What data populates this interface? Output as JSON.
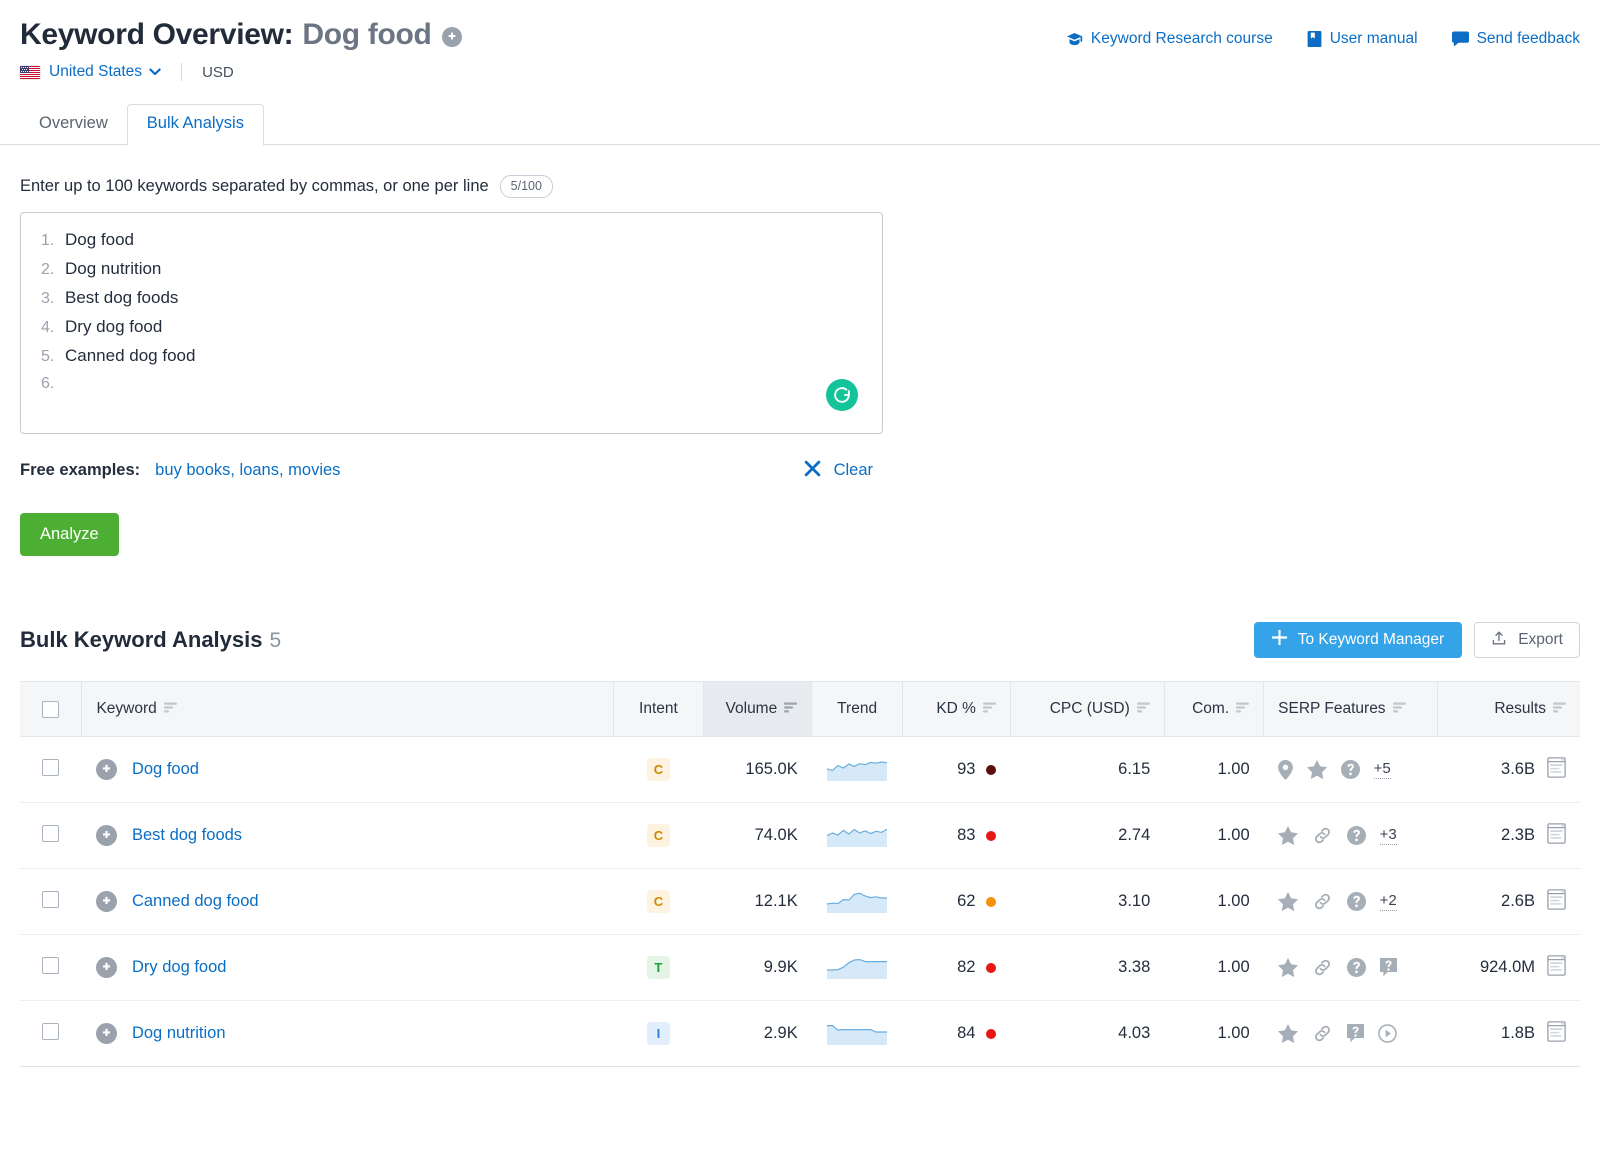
{
  "header": {
    "title_prefix": "Keyword Overview:",
    "keyword": "Dog food",
    "add_icon": "plus-circle-icon",
    "links": [
      {
        "label": "Keyword Research course",
        "icon": "graduation-cap-icon"
      },
      {
        "label": "User manual",
        "icon": "book-icon"
      },
      {
        "label": "Send feedback",
        "icon": "speech-bubble-icon"
      }
    ],
    "locale": {
      "country": "United States",
      "flag": "us-flag-icon",
      "chevron": "chevron-down-icon",
      "currency": "USD"
    }
  },
  "tabs": [
    {
      "label": "Overview",
      "active": false
    },
    {
      "label": "Bulk Analysis",
      "active": true
    }
  ],
  "input_section": {
    "instruction": "Enter up to 100 keywords separated by commas, or one per line",
    "counter": "5/100",
    "lines": [
      {
        "num": "1.",
        "text": "Dog food"
      },
      {
        "num": "2.",
        "text": "Dog nutrition"
      },
      {
        "num": "3.",
        "text": "Best dog foods"
      },
      {
        "num": "4.",
        "text": "Dry dog food"
      },
      {
        "num": "5.",
        "text": "Canned dog food"
      },
      {
        "num": "6.",
        "text": ""
      }
    ],
    "grammarly_icon": "grammarly-icon",
    "examples_label": "Free examples:",
    "examples_link": "buy books, loans, movies",
    "clear_label": "Clear",
    "clear_icon": "close-x-icon",
    "analyze_label": "Analyze"
  },
  "results": {
    "title": "Bulk Keyword Analysis",
    "count": "5",
    "to_keyword_manager_label": "To Keyword Manager",
    "to_keyword_manager_icon": "plus-icon",
    "export_label": "Export",
    "export_icon": "upload-icon",
    "columns": [
      {
        "key": "checkbox",
        "label": "",
        "sortable": false,
        "align": "center"
      },
      {
        "key": "keyword",
        "label": "Keyword",
        "sortable": true,
        "align": "left"
      },
      {
        "key": "intent",
        "label": "Intent",
        "sortable": false,
        "align": "center"
      },
      {
        "key": "volume",
        "label": "Volume",
        "sortable": true,
        "align": "right",
        "highlighted": true
      },
      {
        "key": "trend",
        "label": "Trend",
        "sortable": false,
        "align": "center"
      },
      {
        "key": "kd",
        "label": "KD %",
        "sortable": true,
        "align": "right"
      },
      {
        "key": "cpc",
        "label": "CPC (USD)",
        "sortable": true,
        "align": "right"
      },
      {
        "key": "com",
        "label": "Com.",
        "sortable": true,
        "align": "right"
      },
      {
        "key": "serp",
        "label": "SERP Features",
        "sortable": true,
        "align": "left"
      },
      {
        "key": "results",
        "label": "Results",
        "sortable": true,
        "align": "right"
      }
    ],
    "rows": [
      {
        "keyword": "Dog food",
        "intent": "C",
        "volume": "165.0K",
        "trend": [
          0.45,
          0.38,
          0.62,
          0.5,
          0.7,
          0.58,
          0.72,
          0.66,
          0.78,
          0.74,
          0.8,
          0.76
        ],
        "kd": "93",
        "kd_color": "#5c0d0d",
        "cpc": "6.15",
        "com": "1.00",
        "serp_icons": [
          "map-pin-icon",
          "star-icon",
          "question-circle-icon"
        ],
        "serp_more": "+5",
        "results": "3.6B",
        "results_icon": "serp-preview-icon"
      },
      {
        "keyword": "Best dog foods",
        "intent": "C",
        "volume": "74.0K",
        "trend": [
          0.42,
          0.55,
          0.45,
          0.68,
          0.5,
          0.72,
          0.55,
          0.66,
          0.52,
          0.64,
          0.58,
          0.74
        ],
        "kd": "83",
        "kd_color": "#e81515",
        "cpc": "2.74",
        "com": "1.00",
        "serp_icons": [
          "star-icon",
          "link-icon",
          "question-circle-icon"
        ],
        "serp_more": "+3",
        "results": "2.3B",
        "results_icon": "serp-preview-icon"
      },
      {
        "keyword": "Canned dog food",
        "intent": "C",
        "volume": "12.1K",
        "trend": [
          0.3,
          0.34,
          0.32,
          0.52,
          0.5,
          0.78,
          0.84,
          0.7,
          0.62,
          0.66,
          0.6,
          0.6
        ],
        "kd": "62",
        "kd_color": "#f79009",
        "cpc": "3.10",
        "com": "1.00",
        "serp_icons": [
          "star-icon",
          "link-icon",
          "question-circle-icon"
        ],
        "serp_more": "+2",
        "results": "2.6B",
        "results_icon": "serp-preview-icon"
      },
      {
        "keyword": "Dry dog food",
        "intent": "T",
        "volume": "9.9K",
        "trend": [
          0.3,
          0.3,
          0.32,
          0.44,
          0.66,
          0.8,
          0.82,
          0.72,
          0.72,
          0.72,
          0.72,
          0.72
        ],
        "kd": "82",
        "kd_color": "#e81515",
        "cpc": "3.38",
        "com": "1.00",
        "serp_icons": [
          "star-icon",
          "link-icon",
          "question-circle-icon",
          "qa-box-icon"
        ],
        "serp_more": "",
        "results": "924.0M",
        "results_icon": "serp-preview-icon"
      },
      {
        "keyword": "Dog nutrition",
        "intent": "I",
        "volume": "2.9K",
        "trend": [
          0.82,
          0.82,
          0.6,
          0.62,
          0.62,
          0.62,
          0.62,
          0.62,
          0.62,
          0.5,
          0.5,
          0.5
        ],
        "kd": "84",
        "kd_color": "#e81515",
        "cpc": "4.03",
        "com": "1.00",
        "serp_icons": [
          "star-icon",
          "link-icon",
          "qa-box-icon",
          "video-play-icon"
        ],
        "serp_more": "",
        "results": "1.8B",
        "results_icon": "serp-preview-icon"
      }
    ]
  },
  "colors": {
    "link": "#0b6ec4",
    "accent_blue": "#35a3e8",
    "green": "#4caf34",
    "grammarly_green": "#15c39a",
    "trend_fill": "#d6e9f8",
    "trend_stroke": "#6aaee0",
    "icon_gray": "#a6aeb8"
  }
}
